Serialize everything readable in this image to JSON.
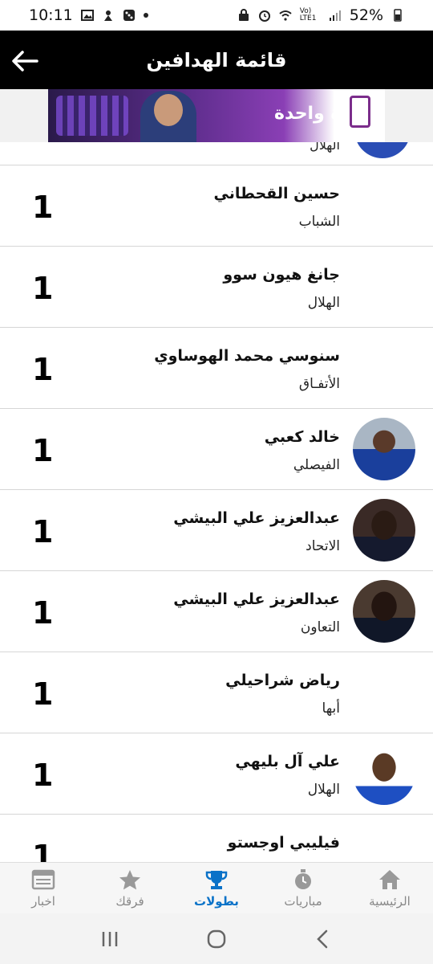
{
  "status_bar": {
    "time": "10:11",
    "battery": "52%",
    "network": "Vo) LTE1"
  },
  "header": {
    "title": "قائمة الهدافين"
  },
  "banner": {
    "text": "بوحدة واحدة"
  },
  "partial_top": {
    "team": "الهلال"
  },
  "scorers": [
    {
      "name": "حسين القحطاني",
      "team": "الشباب",
      "goals": "1",
      "avatar": ""
    },
    {
      "name": "جانغ هيون سوو",
      "team": "الهلال",
      "goals": "1",
      "avatar": ""
    },
    {
      "name": "سنوسي محمد الهوساوي",
      "team": "الأتفـاق",
      "goals": "1",
      "avatar": ""
    },
    {
      "name": "خالد كعبي",
      "team": "الفيصلي",
      "goals": "1",
      "avatar": "av-blue"
    },
    {
      "name": "عبدالعزيز علي البيشي",
      "team": "الاتحاد",
      "goals": "1",
      "avatar": "av-dark1"
    },
    {
      "name": "عبدالعزيز علي البيشي",
      "team": "التعاون",
      "goals": "1",
      "avatar": "av-dark2"
    },
    {
      "name": "رياض شراحيلي",
      "team": "أبها",
      "goals": "1",
      "avatar": ""
    },
    {
      "name": "علي آل بليهي",
      "team": "الهلال",
      "goals": "1",
      "avatar": "av-white"
    },
    {
      "name": "فيليبي اوجستو",
      "team": "",
      "goals": "1",
      "avatar": ""
    }
  ],
  "bottom_nav": [
    {
      "label": "اخبار",
      "icon": "news-icon",
      "active": false
    },
    {
      "label": "فرقك",
      "icon": "star-icon",
      "active": false
    },
    {
      "label": "بطولات",
      "icon": "trophy-icon",
      "active": true
    },
    {
      "label": "مباريات",
      "icon": "stopwatch-icon",
      "active": false
    },
    {
      "label": "الرئيسية",
      "icon": "home-icon",
      "active": false
    }
  ],
  "colors": {
    "header_bg": "#000000",
    "active_nav": "#0a72c8",
    "inactive_nav": "#888888"
  }
}
